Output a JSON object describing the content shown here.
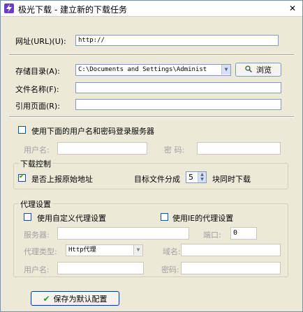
{
  "window": {
    "title": "极光下载 - 建立新的下载任务",
    "close_glyph": "✕"
  },
  "url": {
    "label": "网址(URL)(U):",
    "value": "http://"
  },
  "save_dir": {
    "label": "存储目录(A):",
    "value": "C:\\Documents and Settings\\Administ",
    "browse_label": "浏览"
  },
  "file_name": {
    "label": "文件名称(F):",
    "value": ""
  },
  "referer": {
    "label": "引用页面(R):",
    "value": ""
  },
  "login": {
    "checkbox_label": "使用下面的用户名和密码登录服务器",
    "checked": false,
    "username_label": "用户名:",
    "password_label": "密 码:"
  },
  "download_control": {
    "title": "下载控制",
    "report_checkbox_label": "是否上报原始地址",
    "report_checked": true,
    "split_label": "目标文件分成",
    "split_value": "5",
    "split_suffix": "块同时下载"
  },
  "proxy": {
    "title": "代理设置",
    "custom_checkbox_label": "使用自定义代理设置",
    "custom_checked": false,
    "ie_checkbox_label": "使用IE的代理设置",
    "ie_checked": false,
    "server_label": "服务器:",
    "port_label": "端口:",
    "port_value": "0",
    "type_label": "代理类型:",
    "type_value": "Http代理",
    "domain_label": "域名:",
    "username_label": "用户名:",
    "password_label": "密码:"
  },
  "footer": {
    "save_default_label": "保存为默认配置"
  },
  "icons": {
    "app": "lightning-icon",
    "browse": "magnifier-icon",
    "save_default": "green-check-icon"
  },
  "colors": {
    "app_icon": "#6a3cc7",
    "window_bg": "#ece9d8",
    "field_border": "#7f9db9",
    "check_green": "#21a121"
  }
}
